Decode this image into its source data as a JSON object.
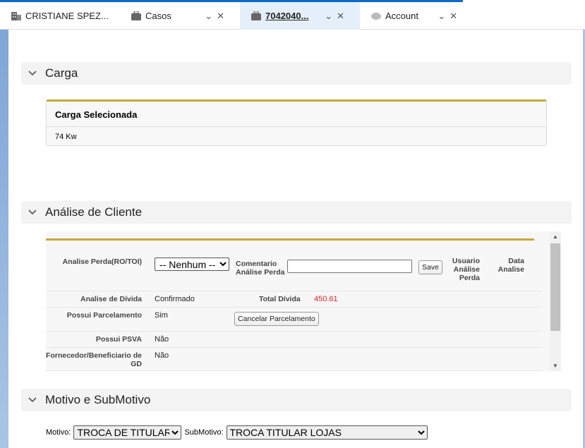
{
  "tabs": [
    {
      "label": "CRISTIANE SPEZ...",
      "icon": "building-icon"
    },
    {
      "label": "Casos",
      "icon": "briefcase-icon"
    },
    {
      "label": "7042040...",
      "icon": "briefcase-icon",
      "active": true
    },
    {
      "label": "Account",
      "icon": "cloud-icon"
    }
  ],
  "sections": {
    "carga": {
      "title": "Carga",
      "card_title": "Carga Selecionada",
      "value": "74 Kw"
    },
    "analise": {
      "title": "Análise de Cliente",
      "analise_perda_label": "Analise Perda(RO/TOI)",
      "analise_perda_value": "-- Nenhum --",
      "comentario_label": "Comentario Análise Perda",
      "comentario_value": "",
      "save": "Save",
      "usuario_label": "Usuario Análise Perda",
      "data_label": "Data Analise",
      "divida_label": "Analise de Dívida",
      "divida_value": "Confirmado",
      "total_label": "Total Dívida",
      "total_value": "450.61",
      "parcel_label": "Possui Parcelamento",
      "parcel_value": "Sim",
      "cancel_btn": "Cancelar Parcelamento",
      "psva_label": "Possui PSVA",
      "psva_value": "Não",
      "gd_label": "Fornecedor/Beneficiario de GD",
      "gd_value": "Não"
    },
    "motivo": {
      "title": "Motivo e SubMotivo",
      "motivo_label": "Motivo:",
      "motivo_value": "TROCA DE TITULAR",
      "sub_label": "SubMotivo:",
      "sub_value": "TROCA TITULAR LOJAS"
    }
  },
  "colors": {
    "accent": "#0b6bcb",
    "gold": "#c4a73f",
    "total": "#e8202a"
  }
}
